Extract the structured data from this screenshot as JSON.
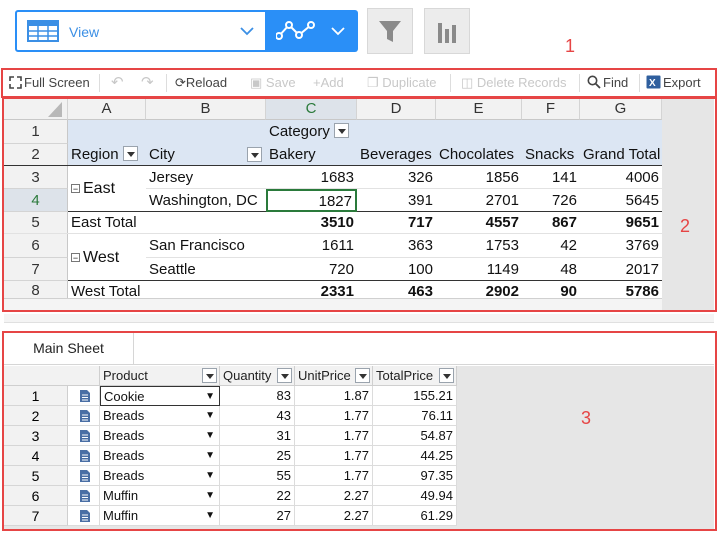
{
  "view_selector": {
    "label": "View",
    "icon": "table-grid-icon"
  },
  "annotations": {
    "one": "1",
    "two": "2",
    "three": "3"
  },
  "toolbar": {
    "full_screen": "Full Screen",
    "reload": "Reload",
    "save": "Save",
    "add": "Add",
    "duplicate": "Duplicate",
    "delete_records": "Delete Records",
    "find": "Find",
    "export": "Export"
  },
  "pivot": {
    "column_letters": [
      "A",
      "B",
      "C",
      "D",
      "E",
      "F",
      "G"
    ],
    "row_numbers": [
      "1",
      "2",
      "3",
      "4",
      "5",
      "6",
      "7",
      "8"
    ],
    "category_label": "Category",
    "region_label": "Region",
    "city_label": "City",
    "headers": [
      "Bakery",
      "Beverages",
      "Chocolates",
      "Snacks",
      "Grand Total"
    ],
    "rows": [
      {
        "region": "East",
        "city": "Jersey",
        "values": [
          "1683",
          "326",
          "1856",
          "141",
          "4006"
        ]
      },
      {
        "region": "",
        "city": "Washington, DC",
        "values": [
          "1827",
          "391",
          "2701",
          "726",
          "5645"
        ]
      },
      {
        "total_label": "East Total",
        "values": [
          "3510",
          "717",
          "4557",
          "867",
          "9651"
        ]
      },
      {
        "region": "West",
        "city": "San Francisco",
        "values": [
          "1611",
          "363",
          "1753",
          "42",
          "3769"
        ]
      },
      {
        "region": "",
        "city": "Seattle",
        "values": [
          "720",
          "100",
          "1149",
          "48",
          "2017"
        ]
      },
      {
        "total_label": "West Total",
        "values": [
          "2331",
          "463",
          "2902",
          "90",
          "5786"
        ]
      }
    ]
  },
  "main_sheet": {
    "tab_label": "Main Sheet",
    "columns": [
      "Product",
      "Quantity",
      "UnitPrice",
      "TotalPrice"
    ],
    "rows": [
      {
        "num": "1",
        "product": "Cookie",
        "quantity": "83",
        "unit_price": "1.87",
        "total_price": "155.21"
      },
      {
        "num": "2",
        "product": "Breads",
        "quantity": "43",
        "unit_price": "1.77",
        "total_price": "76.11"
      },
      {
        "num": "3",
        "product": "Breads",
        "quantity": "31",
        "unit_price": "1.77",
        "total_price": "54.87"
      },
      {
        "num": "4",
        "product": "Breads",
        "quantity": "25",
        "unit_price": "1.77",
        "total_price": "44.25"
      },
      {
        "num": "5",
        "product": "Breads",
        "quantity": "55",
        "unit_price": "1.77",
        "total_price": "97.35"
      },
      {
        "num": "6",
        "product": "Muffin",
        "quantity": "22",
        "unit_price": "2.27",
        "total_price": "49.94"
      },
      {
        "num": "7",
        "product": "Muffin",
        "quantity": "27",
        "unit_price": "2.27",
        "total_price": "61.29"
      }
    ]
  },
  "colors": {
    "accent": "#2a8ff7",
    "annotation": "#e64545",
    "selection": "#2a7a3b",
    "pivot_header": "#dce6f3"
  }
}
